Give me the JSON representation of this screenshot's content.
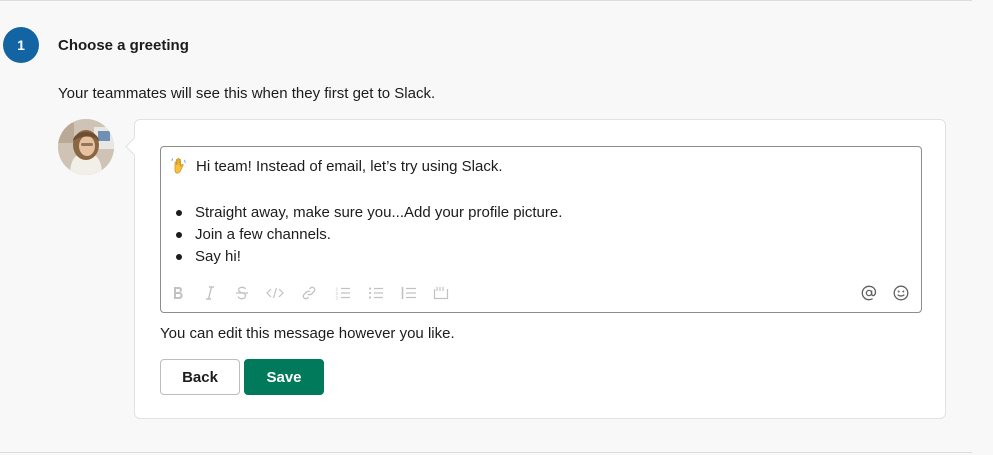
{
  "step": {
    "number": "1",
    "title": "Choose a greeting",
    "description": "Your teammates will see this when they first get to Slack."
  },
  "message": {
    "greeting": "Hi team! Instead of email, let’s try using Slack.",
    "items": [
      "Straight away, make sure you...Add your profile picture.",
      "Join a few channels.",
      "Say hi!"
    ]
  },
  "toolbar": {
    "icons": [
      "bold-icon",
      "italic-icon",
      "strikethrough-icon",
      "code-icon",
      "link-icon",
      "ordered-list-icon",
      "bulleted-list-icon",
      "quote-icon",
      "code-block-icon",
      "mention-icon",
      "emoji-icon"
    ]
  },
  "hint": "You can edit this message however you like.",
  "actions": {
    "back_label": "Back",
    "save_label": "Save"
  },
  "colors": {
    "step_badge": "#1264a3",
    "save_button": "#007a5a",
    "background": "#f8f8f8"
  }
}
